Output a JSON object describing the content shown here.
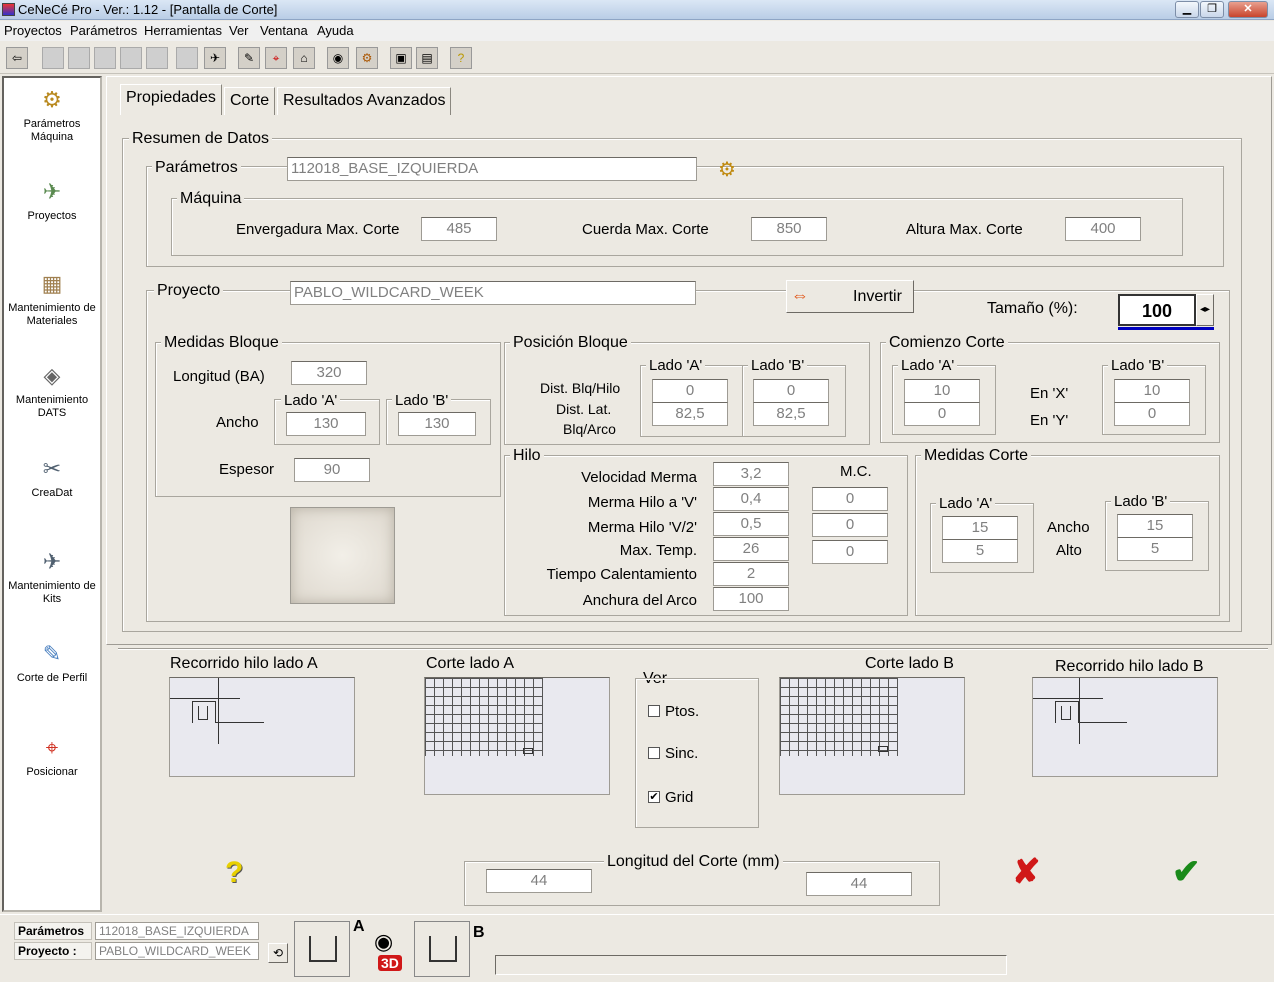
{
  "window": {
    "title": "CeNeCé Pro - Ver.: 1.12 - [Pantalla de Corte]",
    "min": "▁",
    "restore": "❐",
    "close": "✕"
  },
  "menu": [
    "Proyectos",
    "Parámetros",
    "Herramientas",
    "Ver",
    "Ventana",
    "Ayuda"
  ],
  "sidebar": [
    {
      "label": "Parámetros\nMáquina",
      "icon": "gear-icon",
      "glyph": "⚙"
    },
    {
      "label": "Proyectos",
      "icon": "wing-icon",
      "glyph": "✈"
    },
    {
      "label": "Mantenimiento de\nMateriales",
      "icon": "materials-icon",
      "glyph": "▦"
    },
    {
      "label": "Mantenimiento\nDATS",
      "icon": "dats-icon",
      "glyph": "◈"
    },
    {
      "label": "CreaDat",
      "icon": "creadat-icon",
      "glyph": "✂"
    },
    {
      "label": "Mantenimiento de\nKits",
      "icon": "kits-icon",
      "glyph": "✈"
    },
    {
      "label": "Corte de Perfil",
      "icon": "profile-cut-icon",
      "glyph": "✎"
    },
    {
      "label": "Posicionar",
      "icon": "position-icon",
      "glyph": "⌖"
    }
  ],
  "tabs": [
    "Propiedades",
    "Corte",
    "Resultados Avanzados"
  ],
  "resumen": {
    "title": "Resumen de Datos"
  },
  "parametros": {
    "label": "Parámetros",
    "value": "112018_BASE_IZQUIERDA"
  },
  "maquina": {
    "title": "Máquina",
    "env_label": "Envergadura Max. Corte",
    "env": "485",
    "cuerda_label": "Cuerda Max. Corte",
    "cuerda": "850",
    "altura_label": "Altura Max. Corte",
    "altura": "400"
  },
  "proyecto": {
    "label": "Proyecto",
    "value": "PABLO_WILDCARD_WEEK",
    "invertir": "Invertir",
    "tamano_label": "Tamaño (%):",
    "tamano": "100"
  },
  "medidas_bloque": {
    "title": "Medidas Bloque",
    "longitud_label": "Longitud (BA)",
    "longitud": "320",
    "ancho_label": "Ancho",
    "lado_a": "Lado 'A'",
    "lado_b": "Lado 'B'",
    "ancho_a": "130",
    "ancho_b": "130",
    "espesor_label": "Espesor",
    "espesor": "90"
  },
  "posicion_bloque": {
    "title": "Posición Bloque",
    "lado_a": "Lado 'A'",
    "lado_b": "Lado 'B'",
    "dist_label": "Dist. Blq/Hilo",
    "lat_label1": "Dist. Lat.",
    "lat_label2": "Blq/Arco",
    "a_dist": "0",
    "a_lat": "82,5",
    "b_dist": "0",
    "b_lat": "82,5"
  },
  "comienzo": {
    "title": "Comienzo Corte",
    "lado_a": "Lado 'A'",
    "lado_b": "Lado 'B'",
    "enx": "En 'X'",
    "eny": "En 'Y'",
    "a_x": "10",
    "a_y": "0",
    "b_x": "10",
    "b_y": "0"
  },
  "hilo": {
    "title": "Hilo",
    "mc_label": "M.C.",
    "rows": [
      {
        "label": "Velocidad Merma",
        "value": "3,2"
      },
      {
        "label": "Merma Hilo a 'V'",
        "value": "0,4",
        "mc": "0"
      },
      {
        "label": "Merma Hilo 'V/2'",
        "value": "0,5",
        "mc": "0"
      },
      {
        "label": "Max. Temp.",
        "value": "26",
        "mc": "0"
      },
      {
        "label": "Tiempo Calentamiento",
        "value": "2"
      },
      {
        "label": "Anchura del Arco",
        "value": "100"
      }
    ]
  },
  "medidas_corte": {
    "title": "Medidas Corte",
    "lado_a": "Lado 'A'",
    "lado_b": "Lado 'B'",
    "ancho_label": "Ancho",
    "alto_label": "Alto",
    "a_ancho": "15",
    "a_alto": "5",
    "b_ancho": "15",
    "b_alto": "5"
  },
  "previews": {
    "rec_a": "Recorrido hilo lado A",
    "corte_a": "Corte lado A",
    "corte_b": "Corte lado B",
    "rec_b": "Recorrido hilo lado B"
  },
  "ver": {
    "title": "Ver",
    "ptos": "Ptos.",
    "sinc": "Sinc.",
    "grid": "Grid",
    "ptos_checked": false,
    "sinc_checked": false,
    "grid_checked": true,
    "check_mark": "✔"
  },
  "longitud_corte": {
    "title": "Longitud del Corte (mm)",
    "a": "44",
    "b": "44"
  },
  "status": {
    "param_label": "Parámetros :",
    "param_value": "112018_BASE_IZQUIERDA",
    "proj_label": "Proyecto :",
    "proj_value": "PABLO_WILDCARD_WEEK",
    "side_a": "A",
    "side_b": "B",
    "view3d": "3D"
  },
  "colors": {
    "accent_blue": "#0000c0",
    "cancel_red": "#d01818",
    "ok_green": "#1a8a1a",
    "help_yellow": "#e8d000"
  }
}
